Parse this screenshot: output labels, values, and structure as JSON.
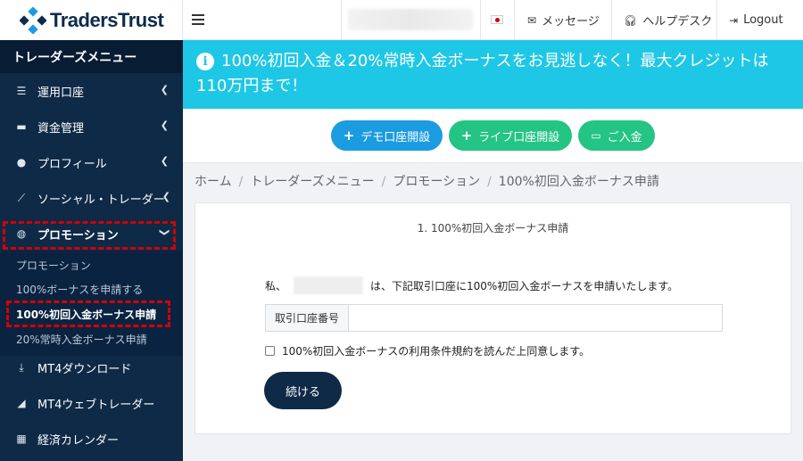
{
  "brand": {
    "name": "TradersTrust"
  },
  "topbar": {
    "flag": "japan-flag",
    "messages_label": "メッセージ",
    "helpdesk_label": "ヘルプデスク",
    "logout_label": "Logout"
  },
  "sidebar": {
    "title": "トレーダーズメニュー",
    "items": [
      {
        "label": "運用口座",
        "icon": "list-icon"
      },
      {
        "label": "資金管理",
        "icon": "wallet-icon"
      },
      {
        "label": "プロフィール",
        "icon": "user-icon"
      },
      {
        "label": "ソーシャル・トレーダー",
        "icon": "chart-line-icon"
      },
      {
        "label": "プロモーション",
        "icon": "globe-icon"
      },
      {
        "label": "MT4ダウンロード",
        "icon": "download-icon"
      },
      {
        "label": "MT4ウェブトレーダー",
        "icon": "area-chart-icon"
      },
      {
        "label": "経済カレンダー",
        "icon": "calendar-icon"
      }
    ],
    "sub_items": [
      {
        "label": "プロモーション"
      },
      {
        "label": "100%ボーナスを申請する"
      },
      {
        "label": "100%初回入金ボーナス申請"
      },
      {
        "label": "20%常時入金ボーナス申請"
      }
    ]
  },
  "banner": {
    "text": "100%初回入金＆20%常時入金ボーナスをお見逃しなく！最大クレジットは110万円まで！"
  },
  "actions": {
    "demo_label": "デモ口座開設",
    "live_label": "ライブ口座開設",
    "deposit_label": "ご入金"
  },
  "breadcrumb": [
    "ホーム",
    "トレーダーズメニュー",
    "プロモーション",
    "100%初回入金ボーナス申請"
  ],
  "form": {
    "title": "1. 100%初回入金ボーナス申請",
    "sentence_prefix": "私、",
    "sentence_suffix": "は、下記取引口座に100%初回入金ボーナスを申請いたします。",
    "account_label": "取引口座番号",
    "account_value": "",
    "agree_label": "100%初回入金ボーナスの利用条件規約を読んだ上同意します。",
    "continue_label": "続ける"
  },
  "colors": {
    "sidebar_bg": "#0e2a47",
    "banner_bg": "#1ec7e6",
    "demo_button": "#1b9be0",
    "live_button": "#23c484",
    "deposit_button": "#23c484",
    "highlight": "#d60000"
  }
}
